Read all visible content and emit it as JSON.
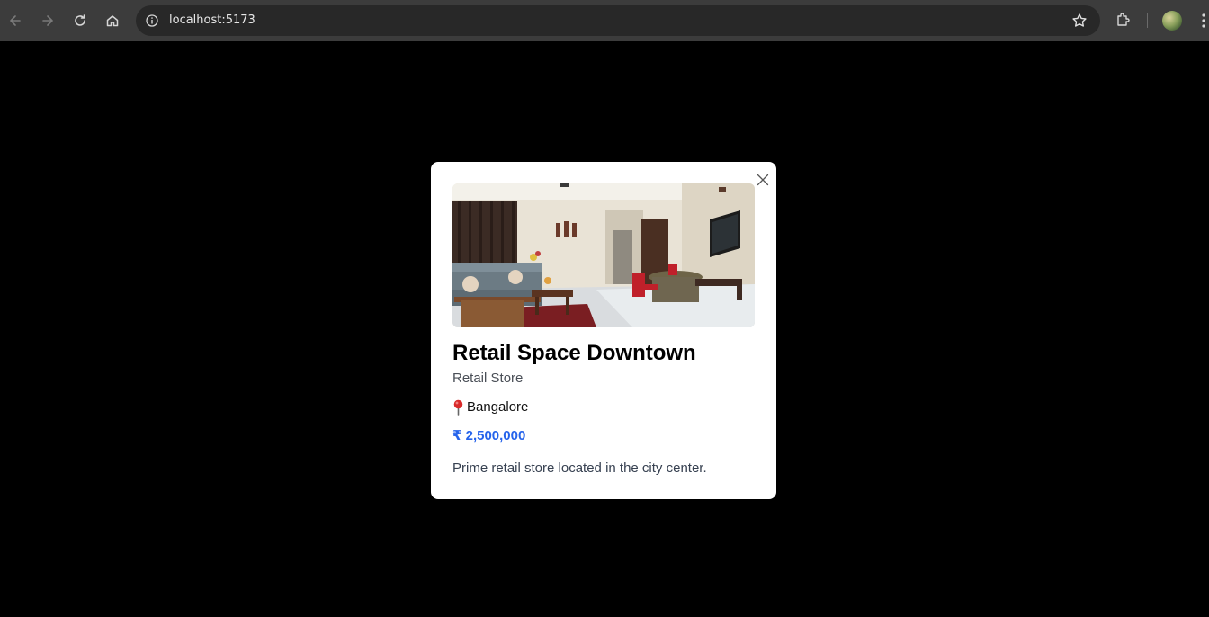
{
  "browser": {
    "url": "localhost:5173",
    "icons": [
      "back-icon",
      "forward-icon",
      "reload-icon",
      "home-icon",
      "info-icon",
      "star-icon",
      "extensions-icon",
      "profile-avatar",
      "menu-icon"
    ]
  },
  "modal": {
    "title": "Retail Space Downtown",
    "category": "Retail Store",
    "location": "Bangalore",
    "price": "₹ 2,500,000",
    "description": "Prime retail store located in the city center.",
    "icons": [
      "close-icon",
      "pin-icon"
    ],
    "colors": {
      "price": "#2563eb",
      "overlay": "#000000",
      "card": "#ffffff"
    }
  }
}
